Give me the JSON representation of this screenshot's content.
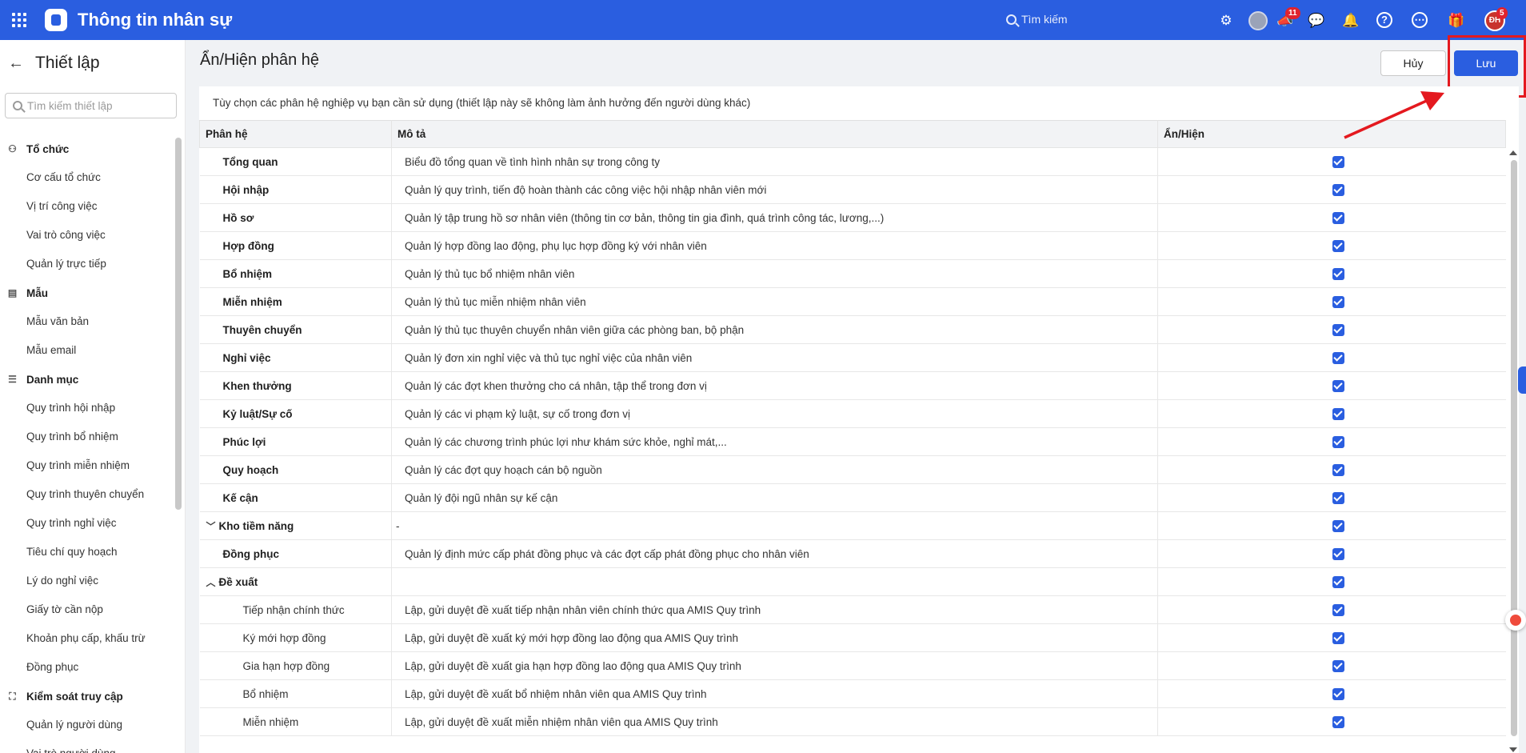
{
  "header": {
    "app_title": "Thông tin nhân sự",
    "search_placeholder": "Tìm kiếm",
    "notification_count_megaphone": "11",
    "user_initials": "ĐH",
    "user_badge": "5",
    "brand_color": "#2a5ee0"
  },
  "sidebar": {
    "title": "Thiết lập",
    "search_placeholder": "Tìm kiếm thiết lập",
    "groups": [
      {
        "label": "Tổ chức",
        "icon": "org-chart-icon",
        "items": [
          "Cơ cấu tổ chức",
          "Vị trí công việc",
          "Vai trò công việc",
          "Quản lý trực tiếp"
        ]
      },
      {
        "label": "Mẫu",
        "icon": "clipboard-icon",
        "items": [
          "Mẫu văn bản",
          "Mẫu email"
        ]
      },
      {
        "label": "Danh mục",
        "icon": "list-icon",
        "items": [
          "Quy trình hội nhập",
          "Quy trình bổ nhiệm",
          "Quy trình miễn nhiệm",
          "Quy trình thuyên chuyển",
          "Quy trình nghỉ việc",
          "Tiêu chí quy hoạch",
          "Lý do nghỉ việc",
          "Giấy tờ cần nộp",
          "Khoản phụ cấp, khấu trừ",
          "Đồng phục"
        ]
      },
      {
        "label": "Kiểm soát truy cập",
        "icon": "access-control-icon",
        "items": [
          "Quản lý người dùng",
          "Vai trò người dùng"
        ]
      }
    ]
  },
  "main": {
    "page_title": "Ẩn/Hiện phân hệ",
    "cancel_label": "Hủy",
    "save_label": "Lưu",
    "description": "Tùy chọn các phân hệ nghiệp vụ bạn cần sử dụng (thiết lập này sẽ không làm ảnh hưởng đến người dùng khác)",
    "columns": [
      "Phân hệ",
      "Mô tả",
      "Ẩn/Hiện"
    ],
    "rows": [
      {
        "name": "Tổng quan",
        "desc": "Biểu đồ tổng quan về tình hình nhân sự trong công ty",
        "checked": true,
        "level": 0
      },
      {
        "name": "Hội nhập",
        "desc": "Quản lý quy trình, tiến độ hoàn thành các công việc hội nhập nhân viên mới",
        "checked": true,
        "level": 0
      },
      {
        "name": "Hồ sơ",
        "desc": "Quản lý tập trung hồ sơ nhân viên (thông tin cơ bản, thông tin gia đình, quá trình công tác, lương,...)",
        "checked": true,
        "level": 0
      },
      {
        "name": "Hợp đồng",
        "desc": "Quản lý hợp đồng lao động, phụ lục hợp đồng ký với nhân viên",
        "checked": true,
        "level": 0
      },
      {
        "name": "Bổ nhiệm",
        "desc": "Quản lý thủ tục bổ nhiệm nhân viên",
        "checked": true,
        "level": 0
      },
      {
        "name": "Miễn nhiệm",
        "desc": "Quản lý thủ tục miễn nhiệm nhân viên",
        "checked": true,
        "level": 0
      },
      {
        "name": "Thuyên chuyển",
        "desc": "Quản lý thủ tục thuyên chuyển nhân viên giữa các phòng ban, bộ phận",
        "checked": true,
        "level": 0
      },
      {
        "name": "Nghỉ việc",
        "desc": "Quản lý đơn xin nghỉ việc và thủ tục nghỉ việc của nhân viên",
        "checked": true,
        "level": 0
      },
      {
        "name": "Khen thưởng",
        "desc": "Quản lý các đợt khen thưởng cho cá nhân, tập thể trong đơn vị",
        "checked": true,
        "level": 0
      },
      {
        "name": "Kỷ luật/Sự cố",
        "desc": "Quản lý các vi phạm kỷ luật, sự cố trong đơn vị",
        "checked": true,
        "level": 0
      },
      {
        "name": "Phúc lợi",
        "desc": "Quản lý các chương trình phúc lợi như khám sức khỏe, nghỉ mát,...",
        "checked": true,
        "level": 0
      },
      {
        "name": "Quy hoạch",
        "desc": "Quản lý các đợt quy hoạch cán bộ nguồn",
        "checked": true,
        "level": 0
      },
      {
        "name": "Kế cận",
        "desc": "Quản lý đội ngũ nhân sự kế cận",
        "checked": true,
        "level": 0
      },
      {
        "name": "Kho tiềm năng",
        "desc": "-",
        "checked": true,
        "level": 0,
        "toggle": "collapsed"
      },
      {
        "name": "Đồng phục",
        "desc": "Quản lý định mức cấp phát đồng phục và các đợt cấp phát đồng phục cho nhân viên",
        "checked": true,
        "level": 0
      },
      {
        "name": "Đề xuất",
        "desc": "",
        "checked": true,
        "level": 0,
        "toggle": "expanded"
      },
      {
        "name": "Tiếp nhận chính thức",
        "desc": "Lập, gửi duyệt đề xuất tiếp nhận nhân viên chính thức qua AMIS Quy trình",
        "checked": true,
        "level": 1
      },
      {
        "name": "Ký mới hợp đồng",
        "desc": "Lập, gửi duyệt đề xuất ký mới hợp đồng lao động qua AMIS Quy trình",
        "checked": true,
        "level": 1
      },
      {
        "name": "Gia hạn hợp đồng",
        "desc": "Lập, gửi duyệt đề xuất gia hạn hợp đồng lao động qua AMIS Quy trình",
        "checked": true,
        "level": 1
      },
      {
        "name": "Bổ nhiệm",
        "desc": "Lập, gửi duyệt đề xuất bổ nhiệm nhân viên qua AMIS Quy trình",
        "checked": true,
        "level": 1
      },
      {
        "name": "Miễn nhiệm",
        "desc": "Lập, gửi duyệt đề xuất miễn nhiệm nhân viên qua AMIS Quy trình",
        "checked": true,
        "level": 1
      }
    ]
  },
  "annotation": {
    "color": "#e4191f"
  }
}
